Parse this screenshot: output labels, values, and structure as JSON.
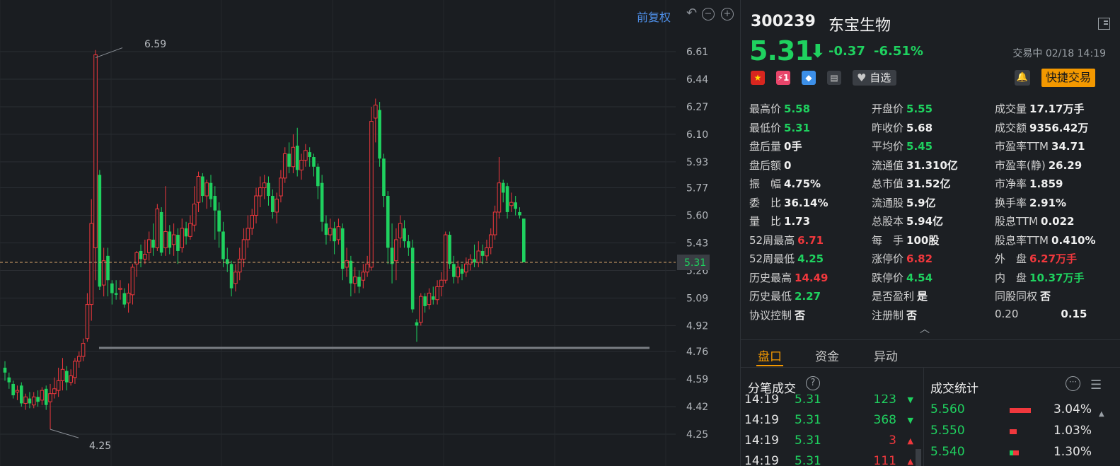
{
  "chart": {
    "fuquan_label": "前复权",
    "price_ticks": [
      "6.61",
      "6.44",
      "6.27",
      "6.10",
      "5.93",
      "5.77",
      "5.60",
      "5.43",
      "5.26",
      "5.09",
      "4.92",
      "4.76",
      "4.59",
      "4.42",
      "4.25"
    ],
    "current_price_tag": "5.31",
    "high_marker": "6.59",
    "low_marker": "4.25",
    "colors": {
      "up": "#f0383d",
      "down": "#1fd15f",
      "bg": "#1a1d21"
    }
  },
  "header": {
    "code": "300239",
    "name": "东宝生物",
    "price": "5.31",
    "change": "-0.37",
    "change_pct": "-6.51%",
    "status": "交易中 02/18 14:19",
    "badge_flash": "⚡1",
    "fav_label": "自选",
    "quick_trade": "快捷交易"
  },
  "stats": {
    "col1": [
      {
        "label": "最高价",
        "value": "5.58",
        "tone": "g"
      },
      {
        "label": "最低价",
        "value": "5.31",
        "tone": "g"
      },
      {
        "label": "盘后量",
        "value": "0手",
        "tone": "w"
      },
      {
        "label": "盘后额",
        "value": "0",
        "tone": "w"
      },
      {
        "label": "振　幅",
        "value": "4.75%",
        "tone": "w"
      },
      {
        "label": "委　比",
        "value": "36.14%",
        "tone": "w"
      },
      {
        "label": "量　比",
        "value": "1.73",
        "tone": "w"
      },
      {
        "label": "52周最高",
        "value": "6.71",
        "tone": "r"
      },
      {
        "label": "52周最低",
        "value": "4.25",
        "tone": "g"
      },
      {
        "label": "历史最高",
        "value": "14.49",
        "tone": "r"
      },
      {
        "label": "历史最低",
        "value": "2.27",
        "tone": "g"
      },
      {
        "label": "协议控制",
        "value": "否",
        "tone": "w"
      }
    ],
    "col2": [
      {
        "label": "开盘价",
        "value": "5.55",
        "tone": "g"
      },
      {
        "label": "昨收价",
        "value": "5.68",
        "tone": "w"
      },
      {
        "label": "平均价",
        "value": "5.45",
        "tone": "g"
      },
      {
        "label": "流通值",
        "value": "31.310亿",
        "tone": "w"
      },
      {
        "label": "总市值",
        "value": "31.52亿",
        "tone": "w"
      },
      {
        "label": "流通股",
        "value": "5.9亿",
        "tone": "w"
      },
      {
        "label": "总股本",
        "value": "5.94亿",
        "tone": "w"
      },
      {
        "label": "每　手",
        "value": "100股",
        "tone": "w"
      },
      {
        "label": "涨停价",
        "value": "6.82",
        "tone": "r"
      },
      {
        "label": "跌停价",
        "value": "4.54",
        "tone": "g"
      },
      {
        "label": "是否盈利",
        "value": "是",
        "tone": "w"
      },
      {
        "label": "注册制",
        "value": "否",
        "tone": "w"
      }
    ],
    "col3": [
      {
        "label": "成交量",
        "value": "17.17万手",
        "tone": "w"
      },
      {
        "label": "成交额",
        "value": "9356.42万",
        "tone": "w"
      },
      {
        "label": "市盈率TTM",
        "value": "34.71",
        "tone": "w"
      },
      {
        "label": "市盈率(静)",
        "value": "26.29",
        "tone": "w"
      },
      {
        "label": "市净率",
        "value": "1.859",
        "tone": "w"
      },
      {
        "label": "换手率",
        "value": "2.91%",
        "tone": "w"
      },
      {
        "label": "股息TTM",
        "value": "0.022",
        "tone": "w"
      },
      {
        "label": "股息率TTM",
        "value": "0.410%",
        "tone": "w"
      },
      {
        "label": "外　盘",
        "value": "6.27万手",
        "tone": "r"
      },
      {
        "label": "内　盘",
        "value": "10.37万手",
        "tone": "g"
      },
      {
        "label": "同股同权",
        "value": "否",
        "tone": "w"
      },
      {
        "label": "0.20",
        "value": "0.15",
        "tone": "w"
      }
    ]
  },
  "tabs": [
    "盘口",
    "资金",
    "异动"
  ],
  "trades_title": "分笔成交",
  "volume_title": "成交统计",
  "trades": [
    {
      "time": "14:19",
      "price": "5.31",
      "qty": "123",
      "dir": "down"
    },
    {
      "time": "14:19",
      "price": "5.31",
      "qty": "368",
      "dir": "down"
    },
    {
      "time": "14:19",
      "price": "5.31",
      "qty": "3",
      "dir": "up"
    },
    {
      "time": "14:19",
      "price": "5.31",
      "qty": "111",
      "dir": "up"
    }
  ],
  "volume_stats": [
    {
      "price": "5.560",
      "pct": "3.04%",
      "share": 0.0304
    },
    {
      "price": "5.550",
      "pct": "1.03%",
      "share": 0.0103
    },
    {
      "price": "5.540",
      "pct": "1.30%",
      "share": 0.013
    }
  ]
}
